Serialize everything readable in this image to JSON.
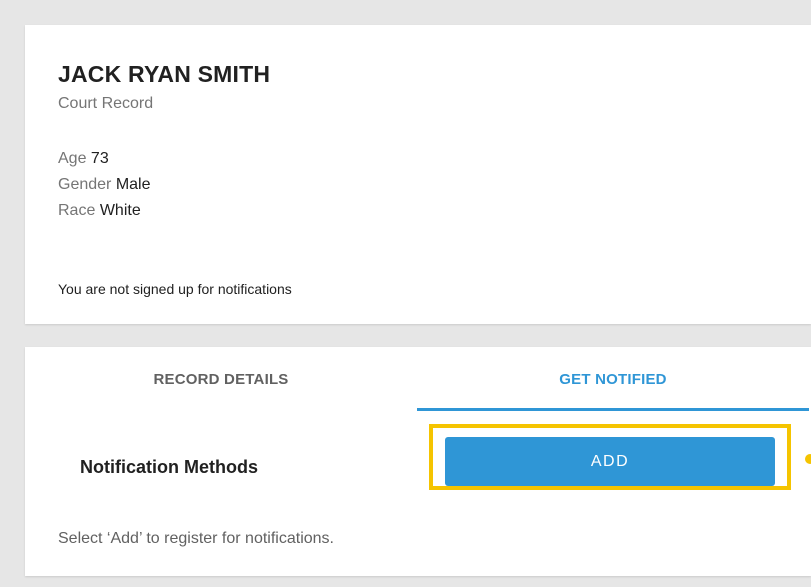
{
  "profile": {
    "name": "JACK RYAN SMITH",
    "record_type": "Court Record",
    "details": [
      {
        "label": "Age",
        "value": "73"
      },
      {
        "label": "Gender",
        "value": "Male"
      },
      {
        "label": "Race",
        "value": "White"
      }
    ],
    "notification_status": "You are not signed up for notifications"
  },
  "tabs": [
    {
      "label": "RECORD DETAILS",
      "active": false
    },
    {
      "label": "GET NOTIFIED",
      "active": true
    }
  ],
  "notifications": {
    "methods_label": "Notification Methods",
    "add_button_label": "ADD",
    "helper_text": "Select ‘Add’ to register for notifications."
  },
  "colors": {
    "accent": "#2f96d6",
    "highlight": "#f5c400",
    "background": "#e6e6e6"
  }
}
